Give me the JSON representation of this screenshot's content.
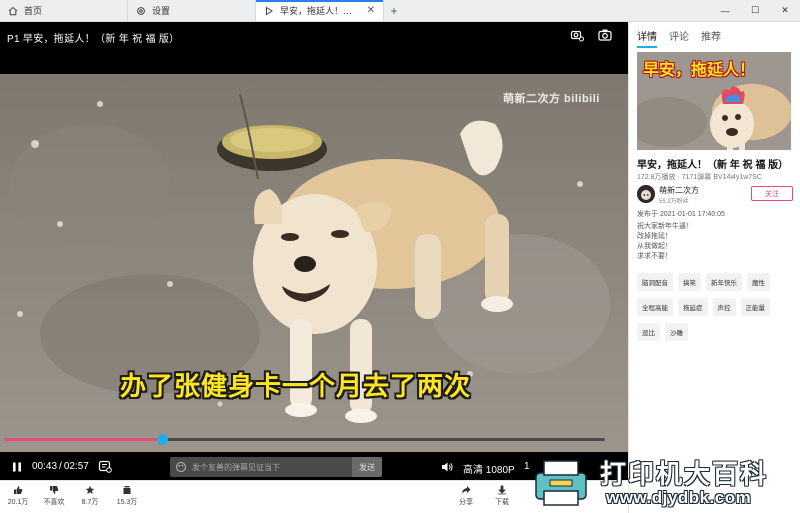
{
  "tabs": [
    {
      "label": "首页",
      "icon": "home-icon"
    },
    {
      "label": "设置",
      "icon": "gear-icon"
    },
    {
      "label": "早安，拖延人！（新 年 祝 福 版",
      "icon": "play-icon",
      "active": true
    }
  ],
  "window": {
    "new_tab": "+"
  },
  "player": {
    "title": "P1 早安，拖延人！（新 年 祝 福 版）",
    "watermark": "萌新二次方 bilibili",
    "subtitle": "办了张健身卡一个月去了两次",
    "progress_fraction": 0.262,
    "current_time": "00:43",
    "duration": "02:57",
    "time_separator": "/",
    "danmaku_placeholder": "发个友善的弹幕见证当下",
    "send_label": "发送",
    "quality": "高清 1080P",
    "speed": "1"
  },
  "actions": [
    {
      "label": "20.1万",
      "icon": "thumbs-up-icon"
    },
    {
      "label": "不喜欢",
      "icon": "thumbs-down-icon"
    },
    {
      "label": "8.7万",
      "icon": "coin-icon"
    },
    {
      "label": "15.3万",
      "icon": "favorite-icon"
    },
    {
      "label": "分享",
      "icon": "share-icon"
    },
    {
      "label": "下载",
      "icon": "download-icon"
    }
  ],
  "side": {
    "tabs": [
      "详情",
      "评论",
      "推荐"
    ],
    "thumb_text": "早安，拖延人！",
    "video_title": "早安，拖延人！（新 年 祝 福 版）",
    "stats": "172.8万播放 · 7171弹幕  BV14i4y1w7SC",
    "uploader": "萌新二次方",
    "fans": "55.2万粉丝",
    "follow_label": "关注",
    "publish": "发布于 2021-01-01 17:40:05",
    "description": [
      "祝大家新年牛逼！",
      "改掉拖延！",
      "从我做起！",
      "求求不要！"
    ],
    "tags": [
      "脑洞配音",
      "搞笑",
      "新年快乐",
      "魔性",
      "全程高能",
      "拖延症",
      "声控",
      "正能量",
      "逗比",
      "沙雕"
    ]
  },
  "site_watermark": {
    "name": "打印机大百科",
    "url": "www.djydbk.com"
  },
  "colors": {
    "accent_blue": "#23ade5",
    "accent_pink": "#e84c7d",
    "subtitle_yellow": "#ffe620"
  }
}
